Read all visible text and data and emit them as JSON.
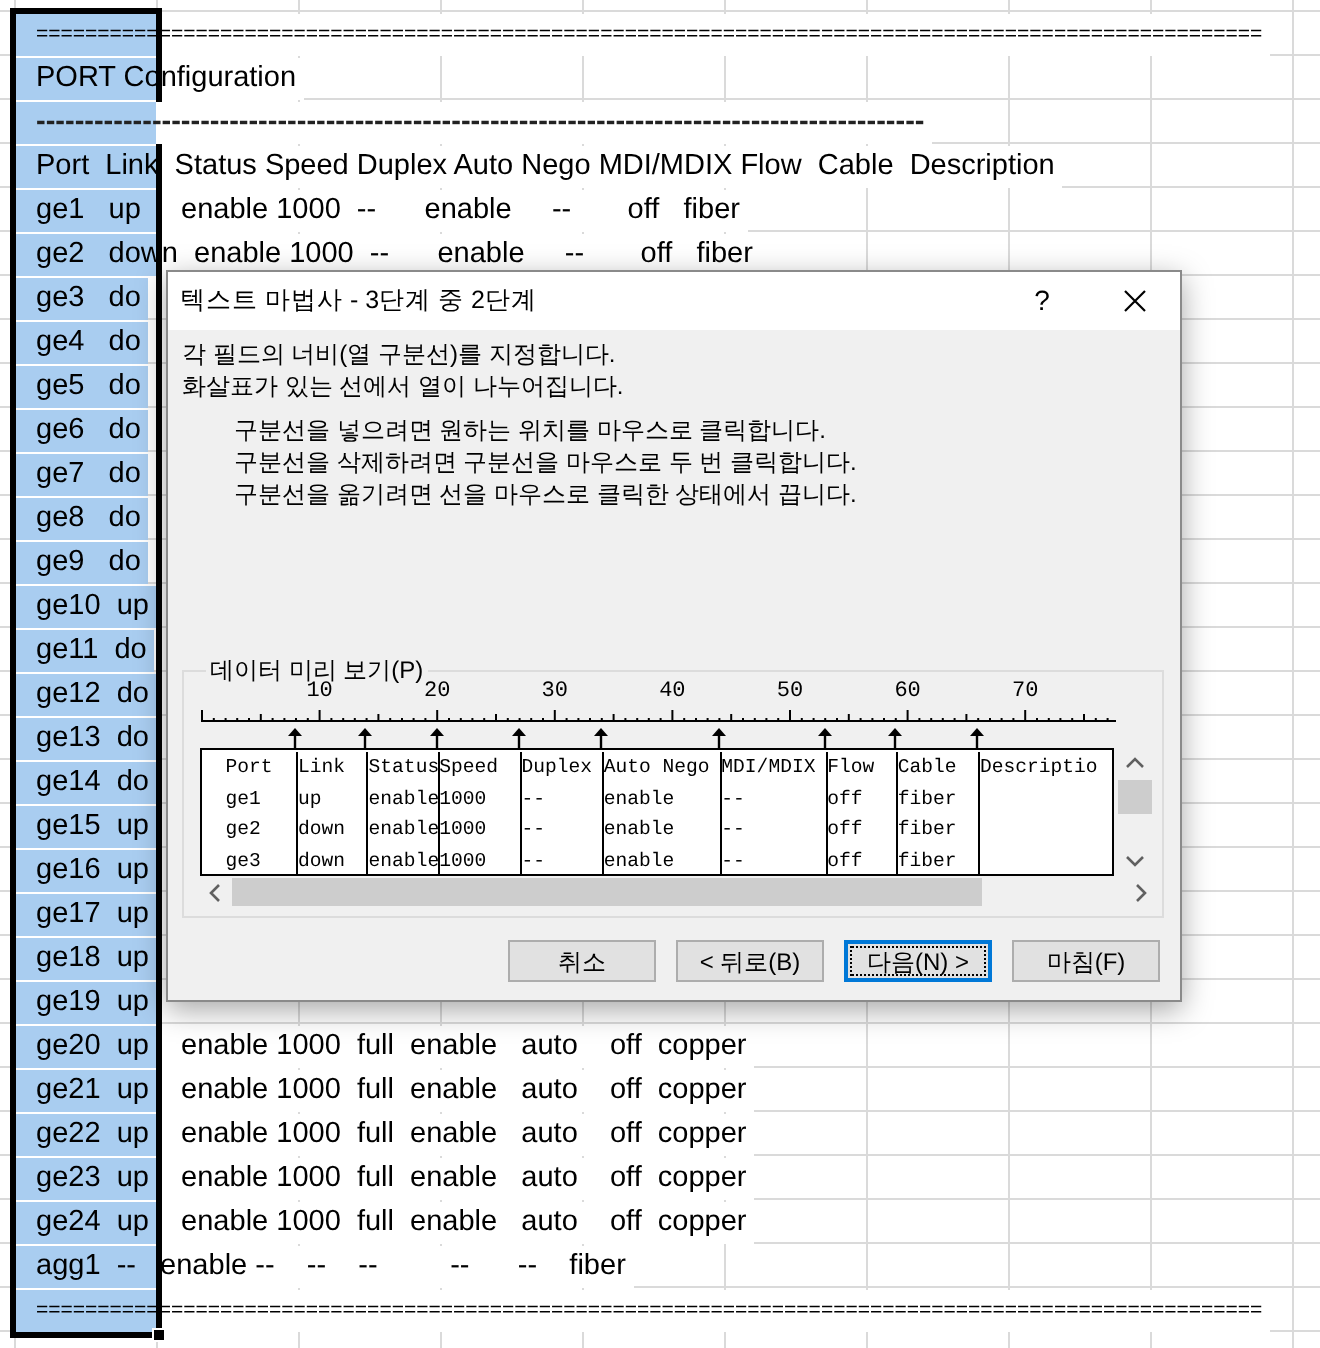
{
  "sheet": {
    "column_a_selected": true,
    "rows": [
      {
        "kind": "rule",
        "text": "===================================================================================================="
      },
      {
        "kind": "text",
        "text": "PORT Configuration"
      },
      {
        "kind": "dashes",
        "text": "--------------------------------------------------------------------------------------------"
      },
      {
        "kind": "text",
        "text": "Port  Link  Status Speed Duplex Auto Nego MDI/MDIX Flow  Cable  Description"
      },
      {
        "kind": "text",
        "text": "ge1   up     enable 1000  --      enable     --       off   fiber"
      },
      {
        "kind": "text",
        "text": "ge2   down  enable 1000  --      enable     --       off   fiber"
      },
      {
        "kind": "text",
        "text": "ge3   do"
      },
      {
        "kind": "text",
        "text": "ge4   do"
      },
      {
        "kind": "text",
        "text": "ge5   do"
      },
      {
        "kind": "text",
        "text": "ge6   do"
      },
      {
        "kind": "text",
        "text": "ge7   do"
      },
      {
        "kind": "text",
        "text": "ge8   do"
      },
      {
        "kind": "text",
        "text": "ge9   do"
      },
      {
        "kind": "text",
        "text": "ge10  up"
      },
      {
        "kind": "text",
        "text": "ge11  do"
      },
      {
        "kind": "text",
        "text": "ge12  do"
      },
      {
        "kind": "text",
        "text": "ge13  do"
      },
      {
        "kind": "text",
        "text": "ge14  do"
      },
      {
        "kind": "text",
        "text": "ge15  up"
      },
      {
        "kind": "text",
        "text": "ge16  up"
      },
      {
        "kind": "text",
        "text": "ge17  up"
      },
      {
        "kind": "text",
        "text": "ge18  up"
      },
      {
        "kind": "text",
        "text": "ge19  up"
      },
      {
        "kind": "text",
        "text": "ge20  up    enable 1000  full  enable   auto    off  copper"
      },
      {
        "kind": "text",
        "text": "ge21  up    enable 1000  full  enable   auto    off  copper"
      },
      {
        "kind": "text",
        "text": "ge22  up    enable 1000  full  enable   auto    off  copper"
      },
      {
        "kind": "text",
        "text": "ge23  up    enable 1000  full  enable   auto    off  copper"
      },
      {
        "kind": "text",
        "text": "ge24  up    enable 1000  full  enable   auto    off  copper"
      },
      {
        "kind": "text",
        "text": "agg1  --   enable --    --    --         --      --    fiber"
      },
      {
        "kind": "rule",
        "text": "===================================================================================================="
      }
    ]
  },
  "dialog": {
    "title": "텍스트 마법사 - 3단계 중 2단계",
    "help_button": "?",
    "instructions": [
      "각 필드의 너비(열 구분선)를 지정합니다.",
      "화살표가 있는 선에서 열이 나누어집니다."
    ],
    "tips": [
      "구분선을 넣으려면 원하는 위치를 마우스로 클릭합니다.",
      "구분선을 삭제하려면 구분선을 마우스로 두 번 클릭합니다.",
      "구분선을 옮기려면 선을 마우스로 클릭한 상태에서 끕니다."
    ],
    "preview": {
      "label": "데이터 미리 보기(P)",
      "ruler_labels": [
        "10",
        "20",
        "30",
        "40",
        "50",
        "60",
        "70"
      ],
      "columns": [
        {
          "header": "Port",
          "values": [
            "ge1",
            "ge2",
            "ge3"
          ]
        },
        {
          "header": "Link",
          "values": [
            "up",
            "down",
            "down"
          ]
        },
        {
          "header": "Status",
          "values": [
            "enable",
            "enable",
            "enable"
          ]
        },
        {
          "header": "Speed",
          "values": [
            "1000",
            "1000",
            "1000"
          ]
        },
        {
          "header": "Duplex",
          "values": [
            "--",
            "--",
            "--"
          ]
        },
        {
          "header": "Auto Nego",
          "values": [
            "enable",
            "enable",
            "enable"
          ]
        },
        {
          "header": "MDI/MDIX",
          "values": [
            "--",
            "--",
            "--"
          ]
        },
        {
          "header": "Flow",
          "values": [
            "off",
            "off",
            "off"
          ]
        },
        {
          "header": "Cable",
          "values": [
            "fiber",
            "fiber",
            "fiber"
          ]
        },
        {
          "header": "Descriptio"
        }
      ]
    },
    "buttons": [
      {
        "label": "취소",
        "default": false
      },
      {
        "label": "< 뒤로(B)",
        "default": false
      },
      {
        "label": "다음(N) >",
        "default": true
      },
      {
        "label": "마침(F)",
        "default": false
      }
    ]
  }
}
